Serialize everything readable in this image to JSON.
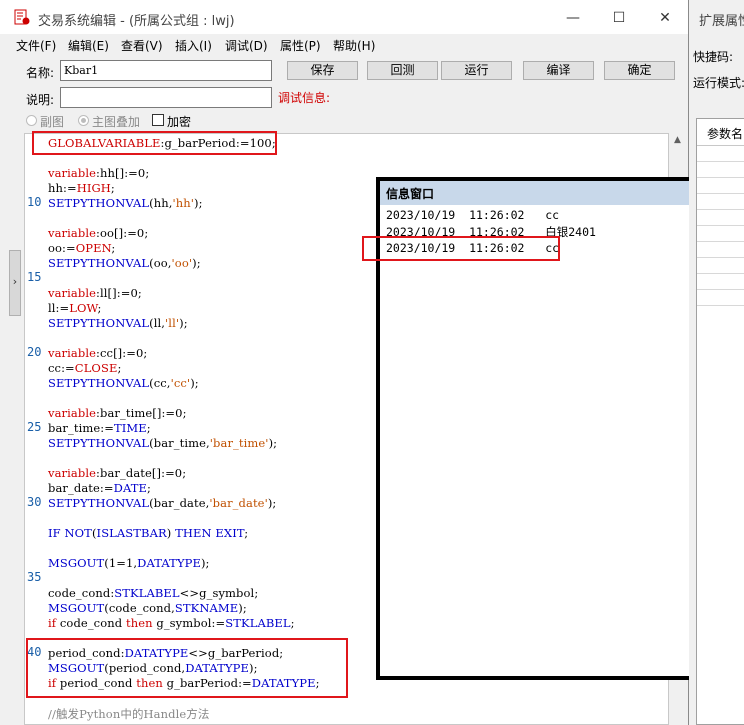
{
  "window": {
    "title": "交易系统编辑 - (所属公式组 : lwj)",
    "minimize": "—",
    "maximize": "☐",
    "close": "✕"
  },
  "menu": [
    "文件(F)",
    "编辑(E)",
    "查看(V)",
    "插入(I)",
    "调试(D)",
    "属性(P)",
    "帮助(H)"
  ],
  "form": {
    "name_label": "名称:",
    "name_value": "Kbar1",
    "desc_label": "说明:",
    "desc_value": "",
    "debug_label": "调试信息:",
    "buttons": {
      "save": "保存",
      "revert": "回测",
      "run": "运行",
      "compile": "编译",
      "ok": "确定"
    },
    "radio_sub": "副图",
    "radio_main": "主图叠加",
    "encrypt": "加密"
  },
  "gutter": {
    "n10": "10",
    "n15": "15",
    "n20": "20",
    "n25": "25",
    "n30": "30",
    "n35": "35",
    "n40": "40"
  },
  "code": {
    "l1_a": "GLOBALVARIABLE",
    "l1_b": ":g_barPeriod:=100;",
    "l3_a": "variable",
    "l3_b": ":hh[]:=0;",
    "l4_a": "hh:=",
    "l4_b": "HIGH",
    "l4_c": ";",
    "l5_a": "SETPYTHONVAL",
    "l5_b": "(hh,",
    "l5_c": "'hh'",
    "l5_d": ");",
    "l7_a": "variable",
    "l7_b": ":oo[]:=0;",
    "l8_a": "oo:=",
    "l8_b": "OPEN",
    "l8_c": ";",
    "l9_a": "SETPYTHONVAL",
    "l9_b": "(oo,",
    "l9_c": "'oo'",
    "l9_d": ");",
    "l11_a": "variable",
    "l11_b": ":ll[]:=0;",
    "l12_a": "ll:=",
    "l12_b": "LOW",
    "l12_c": ";",
    "l13_a": "SETPYTHONVAL",
    "l13_b": "(ll,",
    "l13_c": "'ll'",
    "l13_d": ");",
    "l15_a": "variable",
    "l15_b": ":cc[]:=0;",
    "l16_a": "cc:=",
    "l16_b": "CLOSE",
    "l16_c": ";",
    "l17_a": "SETPYTHONVAL",
    "l17_b": "(cc,",
    "l17_c": "'cc'",
    "l17_d": ");",
    "l19_a": "variable",
    "l19_b": ":bar_time[]:=0;",
    "l20_a": "bar_time:=",
    "l20_b": "TIME",
    "l20_c": ";",
    "l21_a": "SETPYTHONVAL",
    "l21_b": "(bar_time,",
    "l21_c": "'bar_time'",
    "l21_d": ");",
    "l23_a": "variable",
    "l23_b": ":bar_date[]:=0;",
    "l24_a": "bar_date:=",
    "l24_b": "DATE",
    "l24_c": ";",
    "l25_a": "SETPYTHONVAL",
    "l25_b": "(bar_date,",
    "l25_c": "'bar_date'",
    "l25_d": ");",
    "l27_a": "IF NOT",
    "l27_b": "(",
    "l27_c": "ISLASTBAR",
    "l27_d": ") ",
    "l27_e": "THEN EXIT",
    "l27_f": ";",
    "l29_a": "MSGOUT",
    "l29_b": "(1=1,",
    "l29_c": "DATATYPE",
    "l29_d": ");",
    "l31_a": "code_cond:",
    "l31_b": "STKLABEL",
    "l31_c": "<>g_symbol;",
    "l32_a": "MSGOUT",
    "l32_b": "(code_cond,",
    "l32_c": "STKNAME",
    "l32_d": ");",
    "l33_a": "if",
    "l33_b": " code_cond ",
    "l33_c": "then",
    "l33_d": " g_symbol:=",
    "l33_e": "STKLABEL",
    "l33_f": ";",
    "l35_a": "period_cond:",
    "l35_b": "DATATYPE",
    "l35_c": "<>g_barPeriod;",
    "l36_a": "MSGOUT",
    "l36_b": "(period_cond,",
    "l36_c": "DATATYPE",
    "l36_d": ");",
    "l37_a": "if",
    "l37_b": " period_cond ",
    "l37_c": "then",
    "l37_d": " g_barPeriod:=",
    "l37_e": "DATATYPE",
    "l37_f": ";",
    "l39": "//触发Python中的Handle方法"
  },
  "info_window": {
    "title": "信息窗口",
    "close": "✕",
    "lines": [
      "2023/10/19  11:26:02   cc",
      "2023/10/19  11:26:02   白银2401",
      "2023/10/19  11:26:02   cc"
    ]
  },
  "right_panel": {
    "title": "扩展属性",
    "line1": "快捷码:",
    "line2": "运行模式:",
    "table_header": "参数名"
  },
  "colors": {
    "highlight": "#e0161b",
    "keyword": "#cc0000",
    "function": "#0000cc",
    "string": "#c05000",
    "info_title_bg": "#c8d8ea"
  }
}
